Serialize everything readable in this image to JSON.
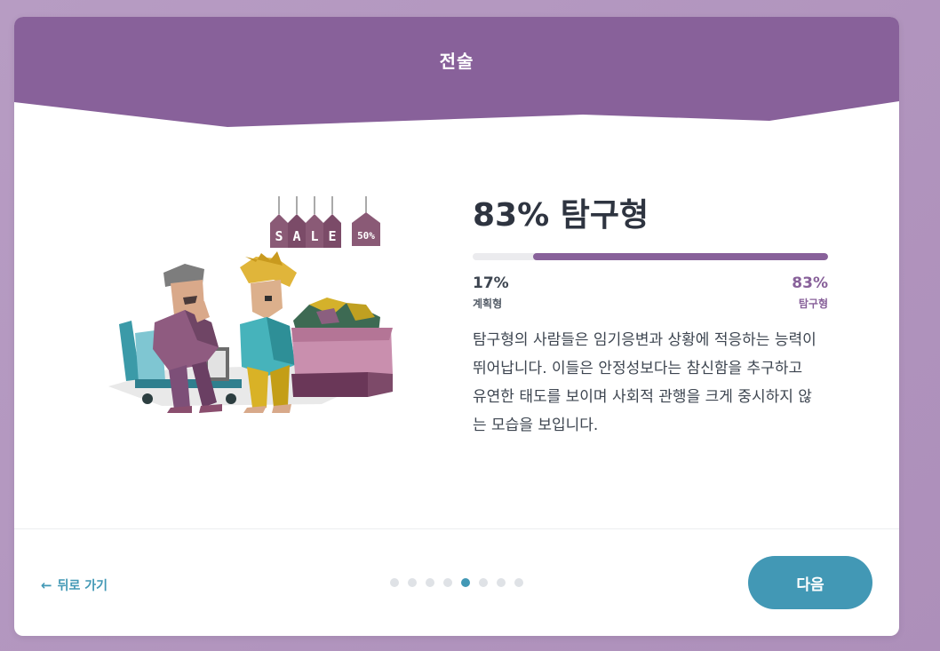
{
  "header": {
    "title": "전술"
  },
  "result": {
    "title": "83% 탐구형",
    "fill_fraction": 0.83,
    "left_percent": "17%",
    "left_label": "계획형",
    "right_percent": "83%",
    "right_label": "탐구형",
    "description": "탐구형의 사람들은 임기응변과 상황에 적응하는 능력이 뛰어납니다. 이들은 안정성보다는 참신함을 추구하고 유연한 태도를 보이며 사회적 관행을 크게 중시하지 않는 모습을 보입니다."
  },
  "illustration": {
    "sale_letters": [
      "S",
      "A",
      "L",
      "E"
    ],
    "discount_tag": "50%"
  },
  "footer": {
    "back_label": "뒤로 가기",
    "next_label": "다음",
    "page_count": 8,
    "active_page": 5
  },
  "colors": {
    "header": "#88619a",
    "accent": "#4298b5",
    "bar_fill": "#88619a",
    "bar_track": "#ebebee"
  }
}
